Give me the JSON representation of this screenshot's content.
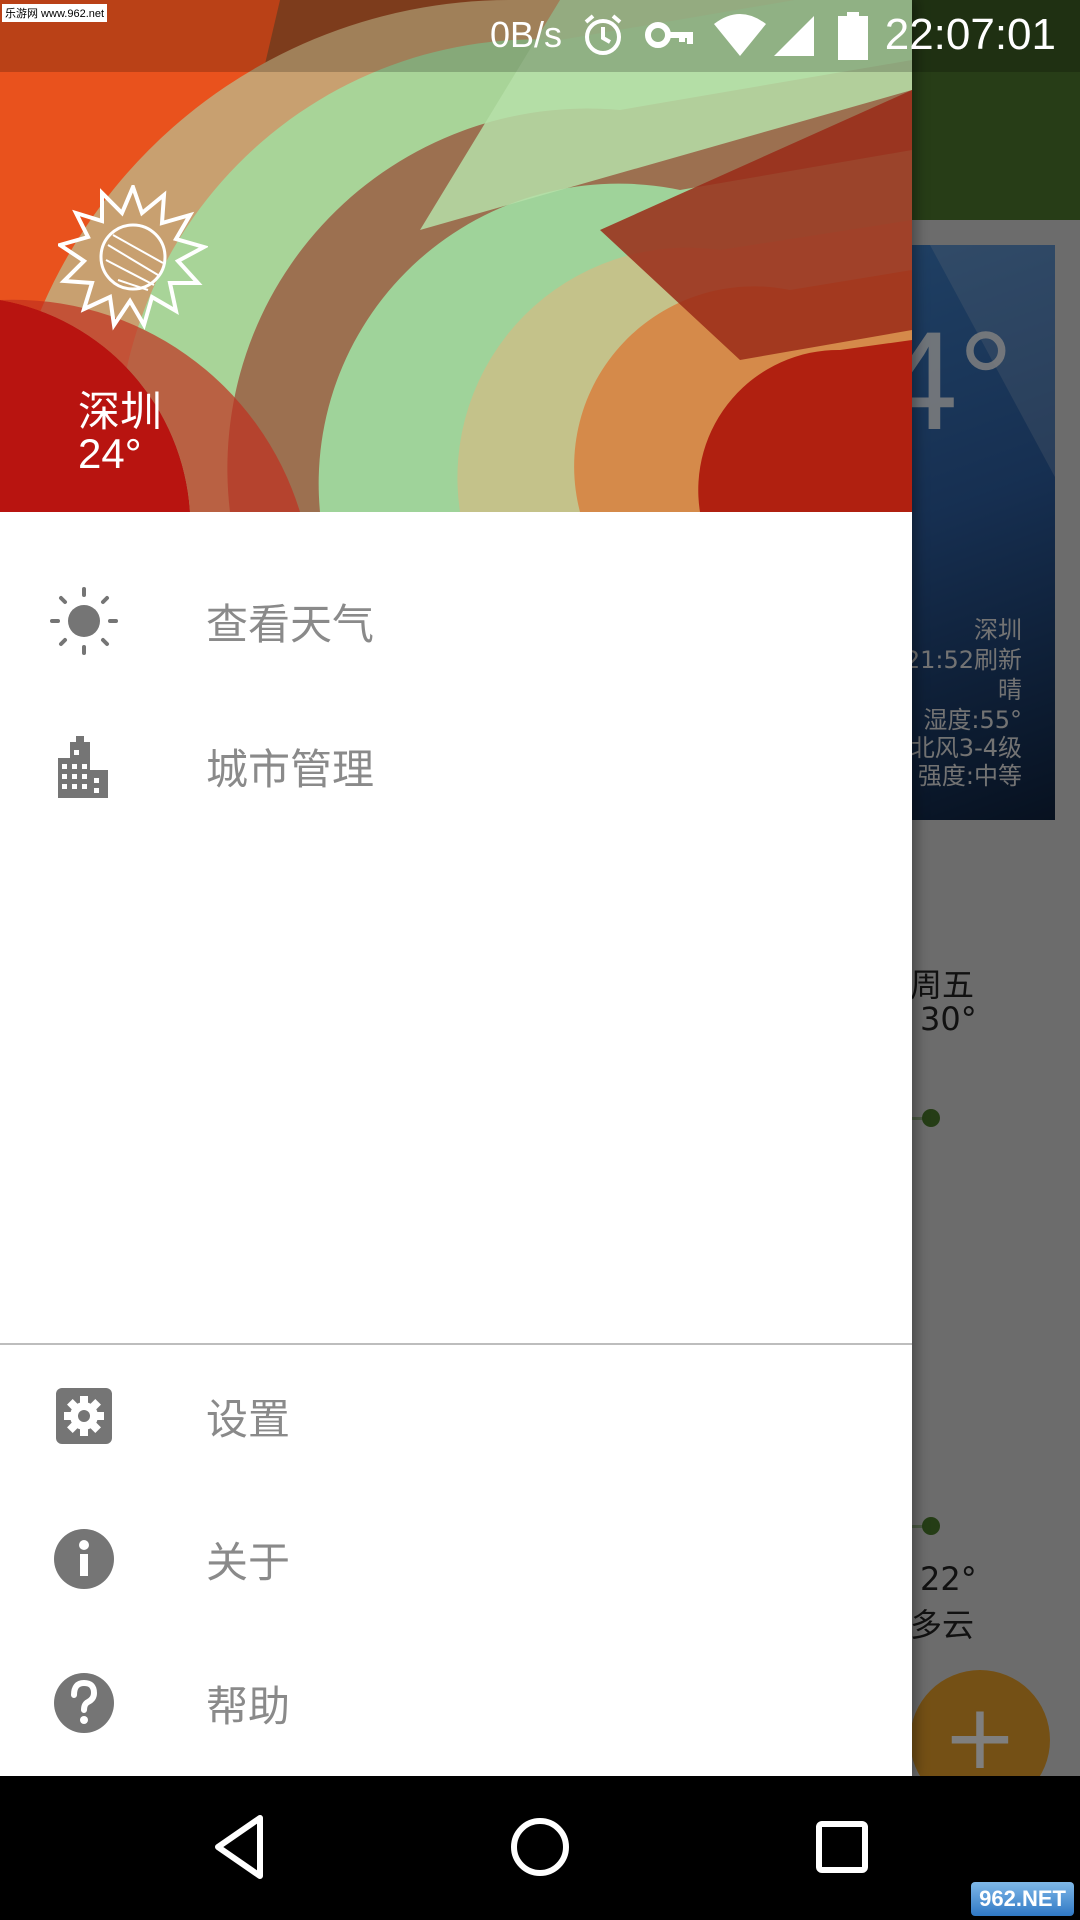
{
  "status_bar": {
    "net_speed": "0B/s",
    "time": "22:07:01",
    "icons": [
      "alarm-icon",
      "vpn-key-icon",
      "wifi-icon",
      "signal-icon",
      "battery-icon"
    ],
    "watermark": "乐游网 www.962.net"
  },
  "drawer": {
    "header": {
      "city": "深圳",
      "temperature": "24°",
      "icon": "sun-sketch-icon"
    },
    "items": [
      {
        "label": "查看天气",
        "icon": "sun-icon"
      },
      {
        "label": "城市管理",
        "icon": "city-buildings-icon"
      }
    ],
    "footer_items": [
      {
        "label": "设置",
        "icon": "settings-gear-icon"
      },
      {
        "label": "关于",
        "icon": "info-icon"
      },
      {
        "label": "帮助",
        "icon": "help-icon"
      }
    ]
  },
  "background_app": {
    "big_temp": "4°",
    "city": "深圳",
    "refresh": "21:52刷新",
    "condition": "晴",
    "humidity": "湿度:55°",
    "wind": "北风3-4级",
    "uv": "强度:中等",
    "forecast_day": "周五",
    "forecast_high": "30°",
    "forecast_low": "22°",
    "forecast_condition": "多云",
    "fab_icon": "plus-icon"
  },
  "nav_bar": {
    "buttons": [
      "back-icon",
      "home-icon",
      "recents-icon"
    ],
    "watermark": "962.NET"
  },
  "colors": {
    "toolbar": "#4e7a2f",
    "drawer_text": "#8a8a8a",
    "icon_gray": "#757575",
    "fab": "#e9a12a"
  }
}
